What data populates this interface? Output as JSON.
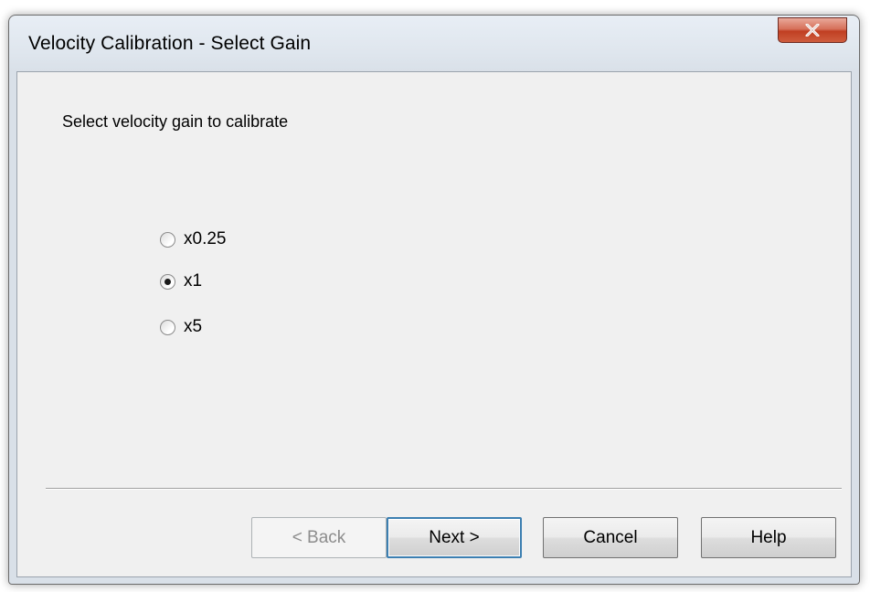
{
  "window": {
    "title": "Velocity Calibration - Select Gain"
  },
  "dialog": {
    "prompt": "Select velocity gain to calibrate",
    "gain_options": [
      {
        "label": "x0.25",
        "selected": false
      },
      {
        "label": "x1",
        "selected": true
      },
      {
        "label": "x5",
        "selected": false
      }
    ]
  },
  "buttons": {
    "back": {
      "label": "< Back",
      "enabled": false
    },
    "next": {
      "label": "Next >",
      "enabled": true
    },
    "cancel": {
      "label": "Cancel",
      "enabled": true
    },
    "help": {
      "label": "Help",
      "enabled": true
    }
  },
  "icons": {
    "close": "close-icon"
  },
  "colors": {
    "close_button": "#c7452a",
    "dialog_background": "#f0f0f0",
    "default_button_border": "#3c7fb1"
  }
}
